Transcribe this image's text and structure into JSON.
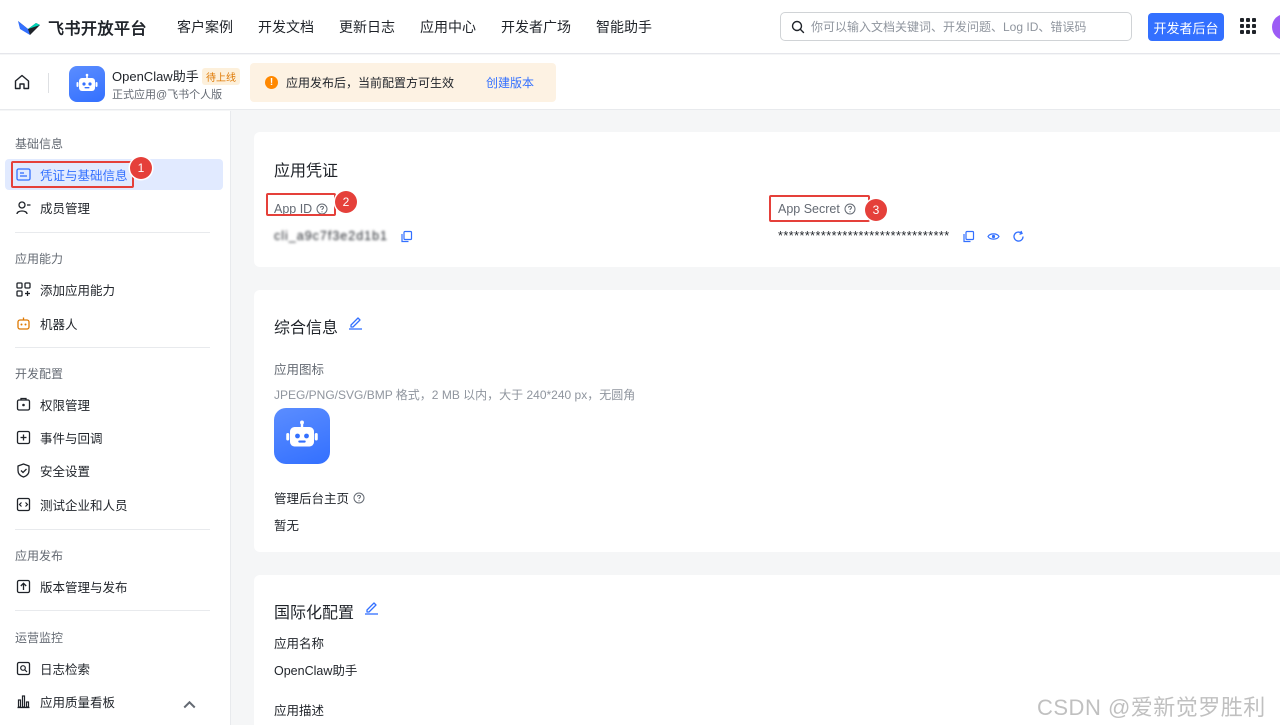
{
  "topnav": {
    "brand": "飞书开放平台",
    "items": [
      "客户案例",
      "开发文档",
      "更新日志",
      "应用中心",
      "开发者广场",
      "智能助手"
    ],
    "search_placeholder": "你可以输入文档关键词、开发问题、Log ID、错误码",
    "dev_console": "开发者后台"
  },
  "app": {
    "name": "OpenClaw助手",
    "status": "待上线",
    "subtitle": "正式应用@飞书个人版",
    "notice": "应用发布后，当前配置方可生效",
    "notice_link": "创建版本"
  },
  "sidebar": {
    "groups": [
      {
        "title": "基础信息",
        "items": [
          "凭证与基础信息",
          "成员管理"
        ]
      },
      {
        "title": "应用能力",
        "items": [
          "添加应用能力",
          "机器人"
        ]
      },
      {
        "title": "开发配置",
        "items": [
          "权限管理",
          "事件与回调",
          "安全设置",
          "测试企业和人员"
        ]
      },
      {
        "title": "应用发布",
        "items": [
          "版本管理与发布"
        ]
      },
      {
        "title": "运营监控",
        "items": [
          "日志检索",
          "应用质量看板"
        ]
      }
    ]
  },
  "credentials": {
    "title": "应用凭证",
    "app_id_label": "App ID",
    "app_id_value": "cli_a9c7f3e2d1b1",
    "app_secret_label": "App Secret",
    "app_secret_value": "********************************"
  },
  "general": {
    "title": "综合信息",
    "icon_label": "应用图标",
    "icon_hint": "JPEG/PNG/SVG/BMP 格式，2 MB 以内，大于 240*240 px，无圆角",
    "admin_label": "管理后台主页",
    "admin_value": "暂无"
  },
  "i18n": {
    "title": "国际化配置",
    "name_label": "应用名称",
    "name_value": "OpenClaw助手",
    "desc_label": "应用描述"
  },
  "callouts": [
    "1",
    "2",
    "3"
  ],
  "watermark": "CSDN @爱新觉罗胜利",
  "colors": {
    "accent": "#3370ff",
    "callout": "#e5403a",
    "warning": "#ff8800"
  }
}
